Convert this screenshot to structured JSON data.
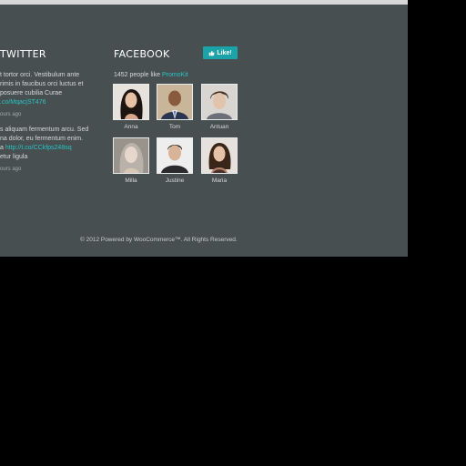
{
  "twitter": {
    "title": "TWITTER",
    "tweets": [
      {
        "lines": [
          "t tortor orci. Vestibulum ante",
          "rimis in faucibus orci luctus et",
          "posuere cubilia Curae"
        ],
        "link": ".co/MqacjST476",
        "time": "ours ago"
      },
      {
        "lines": [
          "s aliquam fermentum arcu. Sed",
          "na dolor, eu fermentum enim."
        ],
        "pre_link": "a ",
        "link": "http://t.co/CCkfps248sq",
        "after": "etur ligula",
        "time": "ours ago"
      }
    ]
  },
  "facebook": {
    "title": "FACEBOOK",
    "like_label": "Like!",
    "people_count_text": "1452 people like ",
    "page_link": "PromoKit",
    "friends": [
      {
        "name": "Anna"
      },
      {
        "name": "Tom"
      },
      {
        "name": "Antuan"
      },
      {
        "name": "Milla"
      },
      {
        "name": "Justine"
      },
      {
        "name": "Maria"
      }
    ]
  },
  "footer": {
    "copyright": "© 2012 Powered by WooCommerce™. All Rights Reserved."
  },
  "colors": {
    "panel_bg": "#474f50",
    "accent": "#1aa3a8",
    "link": "#2ac3c3"
  }
}
